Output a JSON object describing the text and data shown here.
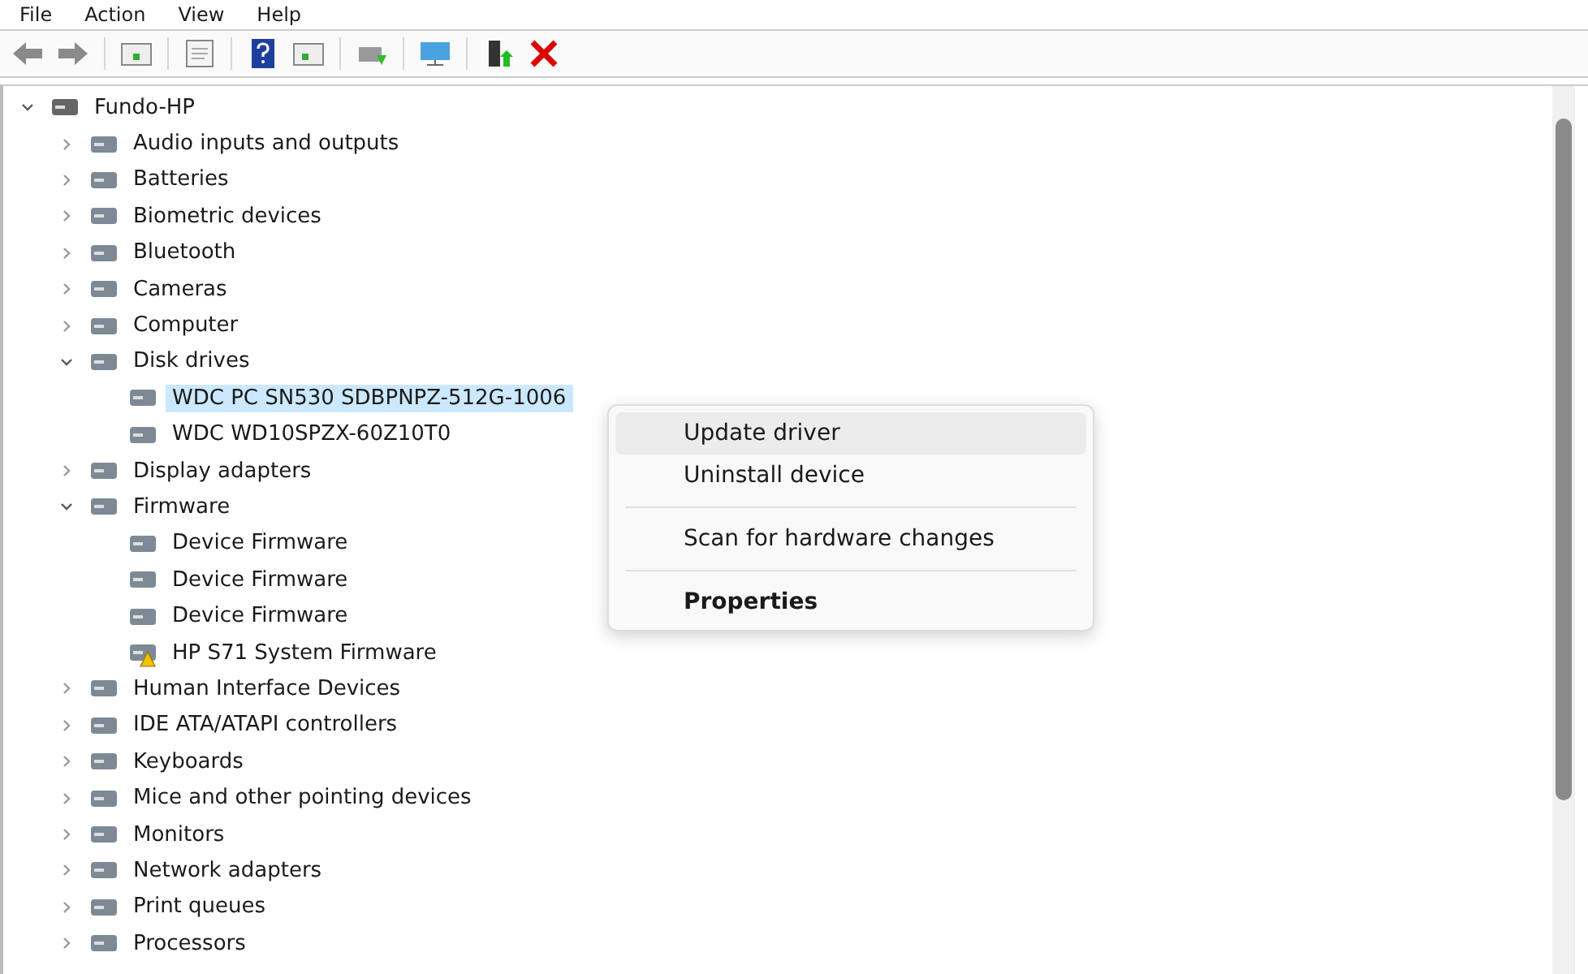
{
  "menu": [
    "File",
    "Action",
    "View",
    "Help"
  ],
  "tree": {
    "label": "Fundo-HP",
    "expanded": true,
    "selected": false,
    "children": [
      {
        "label": "Audio inputs and outputs",
        "expanded": false,
        "selected": false
      },
      {
        "label": "Batteries",
        "expanded": false,
        "selected": false
      },
      {
        "label": "Biometric devices",
        "expanded": false,
        "selected": false
      },
      {
        "label": "Bluetooth",
        "expanded": false,
        "selected": false
      },
      {
        "label": "Cameras",
        "expanded": false,
        "selected": false
      },
      {
        "label": "Computer",
        "expanded": false,
        "selected": false
      },
      {
        "label": "Disk drives",
        "expanded": true,
        "selected": false,
        "children": [
          {
            "label": "WDC PC SN530 SDBPNPZ-512G-1006",
            "selected": true
          },
          {
            "label": "WDC WD10SPZX-60Z10T0",
            "selected": false
          }
        ]
      },
      {
        "label": "Display adapters",
        "expanded": false,
        "selected": false
      },
      {
        "label": "Firmware",
        "expanded": true,
        "selected": false,
        "children": [
          {
            "label": "Device Firmware",
            "selected": false
          },
          {
            "label": "Device Firmware",
            "selected": false
          },
          {
            "label": "Device Firmware",
            "selected": false
          },
          {
            "label": "HP S71 System Firmware",
            "selected": false,
            "warning": true
          }
        ]
      },
      {
        "label": "Human Interface Devices",
        "expanded": false,
        "selected": false
      },
      {
        "label": "IDE ATA/ATAPI controllers",
        "expanded": false,
        "selected": false
      },
      {
        "label": "Keyboards",
        "expanded": false,
        "selected": false
      },
      {
        "label": "Mice and other pointing devices",
        "expanded": false,
        "selected": false
      },
      {
        "label": "Monitors",
        "expanded": false,
        "selected": false
      },
      {
        "label": "Network adapters",
        "expanded": false,
        "selected": false
      },
      {
        "label": "Print queues",
        "expanded": false,
        "selected": false
      },
      {
        "label": "Processors",
        "expanded": false,
        "selected": false
      }
    ]
  },
  "context_menu": [
    {
      "kind": "item",
      "label": "Update driver",
      "selected": true
    },
    {
      "kind": "item",
      "label": "Uninstall device",
      "selected": false
    },
    {
      "kind": "separator"
    },
    {
      "kind": "item",
      "label": "Scan for hardware changes",
      "selected": false
    },
    {
      "kind": "separator"
    },
    {
      "kind": "default",
      "label": "Properties",
      "selected": false
    }
  ]
}
